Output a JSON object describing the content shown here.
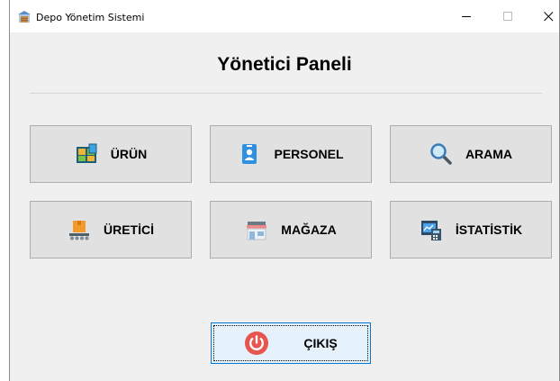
{
  "window": {
    "title": "Depo Yönetim Sistemi",
    "controls": {
      "minimize": "—",
      "maximize": "☐",
      "close": "✕"
    }
  },
  "main": {
    "heading": "Yönetici Paneli",
    "buttons": [
      {
        "label": "ÜRÜN",
        "icon": "inventory-shelf-icon"
      },
      {
        "label": "PERSONEL",
        "icon": "id-badge-icon"
      },
      {
        "label": "ARAMA",
        "icon": "magnifier-icon"
      },
      {
        "label": "ÜRETİCİ",
        "icon": "conveyor-box-icon"
      },
      {
        "label": "MAĞAZA",
        "icon": "store-icon"
      },
      {
        "label": "İSTATİSTİK",
        "icon": "calculator-chart-icon"
      }
    ],
    "exit": {
      "label": "ÇIKIŞ",
      "icon": "power-icon"
    }
  },
  "colors": {
    "window_bg": "#f0f0f0",
    "button_bg": "#e1e1e1",
    "focused_border": "#0078d7",
    "power_red": "#e8544e"
  }
}
